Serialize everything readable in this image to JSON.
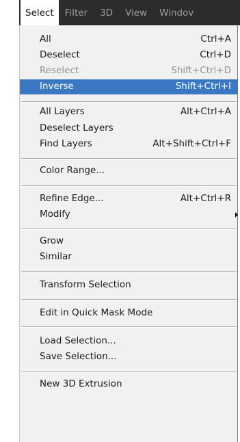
{
  "menubar": {
    "items": [
      "Select",
      "Filter",
      "3D",
      "View",
      "Windov"
    ]
  },
  "menu": {
    "all": {
      "label": "All",
      "shortcut": "Ctrl+A"
    },
    "deselect": {
      "label": "Deselect",
      "shortcut": "Ctrl+D"
    },
    "reselect": {
      "label": "Reselect",
      "shortcut": "Shift+Ctrl+D"
    },
    "inverse": {
      "label": "Inverse",
      "shortcut": "Shift+Ctrl+I"
    },
    "all_layers": {
      "label": "All Layers",
      "shortcut": "Alt+Ctrl+A"
    },
    "deselect_layers": {
      "label": "Deselect Layers"
    },
    "find_layers": {
      "label": "Find Layers",
      "shortcut": "Alt+Shift+Ctrl+F"
    },
    "color_range": {
      "label": "Color Range..."
    },
    "refine_edge": {
      "label": "Refine Edge...",
      "shortcut": "Alt+Ctrl+R"
    },
    "modify": {
      "label": "Modify"
    },
    "grow": {
      "label": "Grow"
    },
    "similar": {
      "label": "Similar"
    },
    "transform_selection": {
      "label": "Transform Selection"
    },
    "quick_mask": {
      "label": "Edit in Quick Mask Mode"
    },
    "load_selection": {
      "label": "Load Selection..."
    },
    "save_selection": {
      "label": "Save Selection..."
    },
    "new_3d_extrusion": {
      "label": "New 3D Extrusion"
    }
  }
}
